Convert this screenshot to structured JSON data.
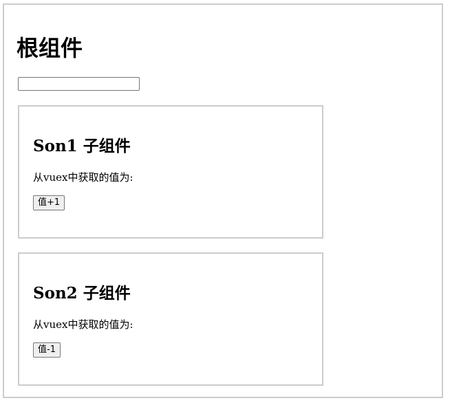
{
  "root": {
    "title": "根组件",
    "input_value": ""
  },
  "son1": {
    "title_latin": "Son1",
    "title_cn": "子组件",
    "text": "从vuex中获取的值为:",
    "button_label": "值+1"
  },
  "son2": {
    "title_latin": "Son2",
    "title_cn": "子组件",
    "text": "从vuex中获取的值为:",
    "button_label": "值-1"
  },
  "colors": {
    "border": "#cccccc",
    "button_bg": "#efefef"
  }
}
